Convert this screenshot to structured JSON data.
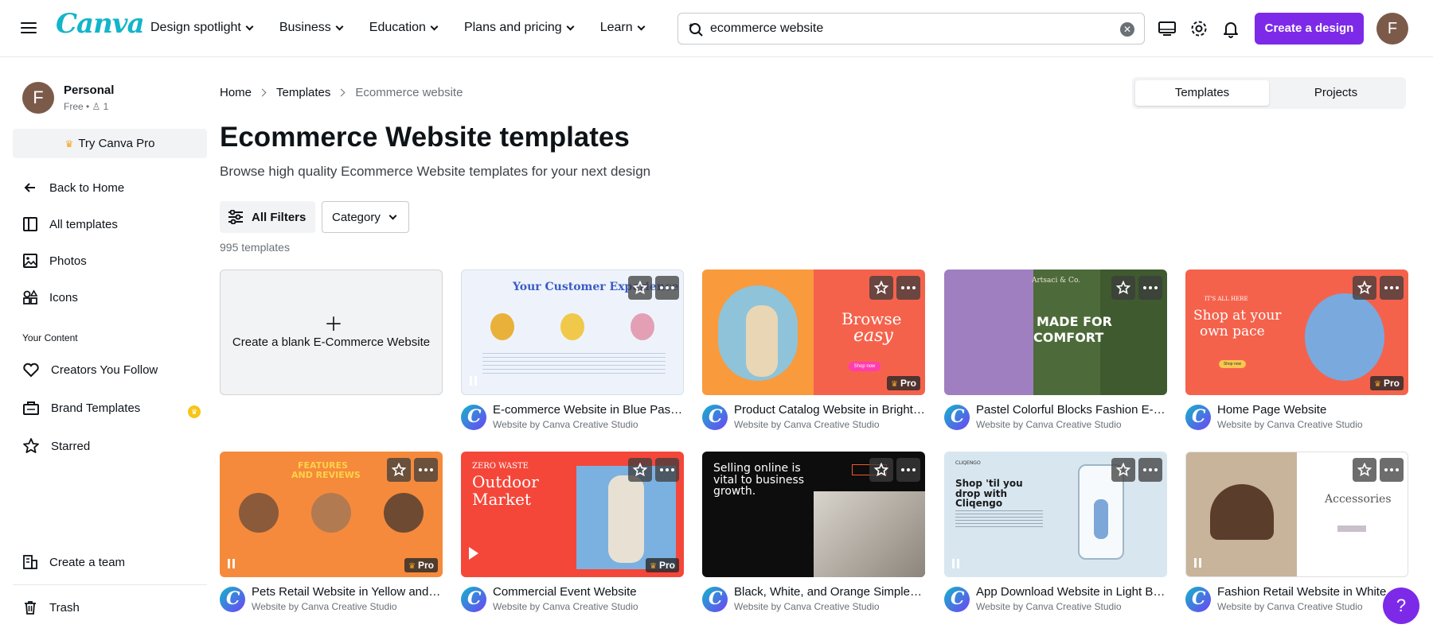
{
  "header": {
    "logo": "Canva",
    "nav": [
      "Design spotlight",
      "Business",
      "Education",
      "Plans and pricing",
      "Learn"
    ],
    "search_value": "ecommerce website",
    "create_label": "Create a design",
    "avatar_initial": "F",
    "brand_color": "#7d2ae8"
  },
  "sidebar": {
    "profile_name": "Personal",
    "profile_plan": "Free • ♙ 1",
    "avatar_initial": "F",
    "try_pro": "Try Canva Pro",
    "items": [
      "Back to Home",
      "All templates",
      "Photos",
      "Icons"
    ],
    "section_heading": "Your Content",
    "content_items": [
      "Creators You Follow",
      "Brand Templates",
      "Starred"
    ],
    "bottom_items": [
      "Create a team",
      "Trash"
    ]
  },
  "main": {
    "breadcrumb": [
      "Home",
      "Templates",
      "Ecommerce website"
    ],
    "toggle": [
      "Templates",
      "Projects"
    ],
    "title": "Ecommerce Website templates",
    "subtitle": "Browse high quality Ecommerce Website templates for your next design",
    "filters_label": "All Filters",
    "category_label": "Category",
    "count": "995 templates",
    "blank_label": "Create a blank E-Commerce Website",
    "pro_label": "Pro",
    "by_label": "Website by Canva Creative Studio",
    "templates": [
      {
        "name": "E-commerce Website in Blue Pastel Light Style",
        "pro": false
      },
      {
        "name": "Product Catalog Website in Bright Orange Style",
        "pro": true
      },
      {
        "name": "Pastel Colorful Blocks Fashion E-commerce Website",
        "pro": false
      },
      {
        "name": "Home Page Website",
        "pro": true
      },
      {
        "name": "Pets Retail Website in Yellow and Orange",
        "pro": true
      },
      {
        "name": "Commercial Event Website",
        "pro": true
      },
      {
        "name": "Black, White, and Orange Simple E-commerce Website",
        "pro": false
      },
      {
        "name": "App Download Website in Light Blue",
        "pro": false
      },
      {
        "name": "Fashion Retail Website in White",
        "pro": false
      }
    ],
    "thumb_text": {
      "t1": "Your Customer Experience",
      "t2a": "Browse",
      "t2b": "easy",
      "t2c": "Shop now",
      "t3a": "Artsaci & Co.",
      "t3b": "MADE FOR",
      "t3c": "COMFORT",
      "t4a": "IT'S ALL HERE",
      "t4b": "Shop at your",
      "t4c": "own pace",
      "t4d": "Shop now",
      "t5a": "FEATURES",
      "t5b": "AND REVIEWS",
      "t6a": "ZERO WASTE",
      "t6b": "Outdoor",
      "t6c": "Market",
      "t7": "Selling online is vital to business growth.",
      "t8a": "CLIQENGO",
      "t8b": "Shop 'til you drop with Cliqengo",
      "t9": "Accessories"
    }
  },
  "help_label": "?"
}
